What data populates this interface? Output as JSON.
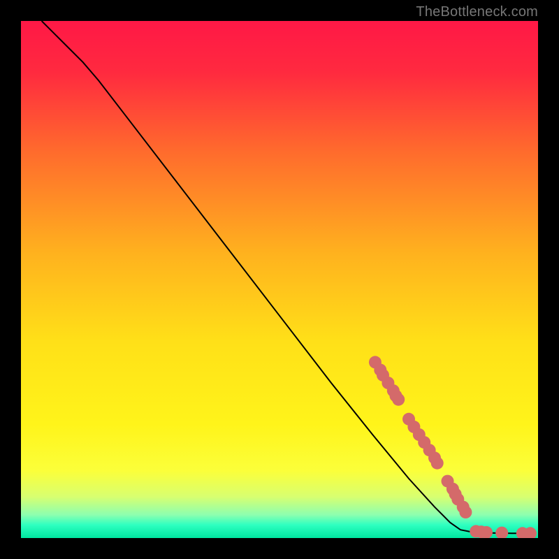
{
  "watermark": "TheBottleneck.com",
  "chart_data": {
    "type": "line",
    "title": "",
    "xlabel": "",
    "ylabel": "",
    "xlim": [
      0,
      100
    ],
    "ylim": [
      0,
      100
    ],
    "background_gradient_stops": [
      {
        "offset": 0.0,
        "color": "#ff1846"
      },
      {
        "offset": 0.1,
        "color": "#ff2a3f"
      },
      {
        "offset": 0.25,
        "color": "#ff6a2d"
      },
      {
        "offset": 0.45,
        "color": "#ffb21e"
      },
      {
        "offset": 0.62,
        "color": "#ffe018"
      },
      {
        "offset": 0.78,
        "color": "#fff41a"
      },
      {
        "offset": 0.87,
        "color": "#fbff3a"
      },
      {
        "offset": 0.92,
        "color": "#d8ff70"
      },
      {
        "offset": 0.955,
        "color": "#8dffaf"
      },
      {
        "offset": 0.975,
        "color": "#2dffc0"
      },
      {
        "offset": 1.0,
        "color": "#00e6a0"
      }
    ],
    "series": [
      {
        "name": "curve",
        "type": "line",
        "color": "#000000",
        "points": [
          {
            "x": 4,
            "y": 100
          },
          {
            "x": 6,
            "y": 98
          },
          {
            "x": 9,
            "y": 95
          },
          {
            "x": 12,
            "y": 92
          },
          {
            "x": 15,
            "y": 88.5
          },
          {
            "x": 20,
            "y": 82
          },
          {
            "x": 30,
            "y": 69
          },
          {
            "x": 40,
            "y": 56
          },
          {
            "x": 50,
            "y": 43
          },
          {
            "x": 60,
            "y": 30
          },
          {
            "x": 68,
            "y": 20
          },
          {
            "x": 75,
            "y": 11.5
          },
          {
            "x": 80,
            "y": 6
          },
          {
            "x": 83,
            "y": 3
          },
          {
            "x": 85,
            "y": 1.6
          },
          {
            "x": 87,
            "y": 1.2
          },
          {
            "x": 90,
            "y": 1.0
          },
          {
            "x": 95,
            "y": 0.9
          },
          {
            "x": 99,
            "y": 0.9
          }
        ]
      },
      {
        "name": "markers",
        "type": "scatter",
        "color": "#d46a6a",
        "points": [
          {
            "x": 68.5,
            "y": 34.0
          },
          {
            "x": 69.5,
            "y": 32.5
          },
          {
            "x": 70.0,
            "y": 31.5
          },
          {
            "x": 71.0,
            "y": 30.0
          },
          {
            "x": 72.0,
            "y": 28.5
          },
          {
            "x": 72.5,
            "y": 27.5
          },
          {
            "x": 73.0,
            "y": 26.8
          },
          {
            "x": 75.0,
            "y": 23.0
          },
          {
            "x": 76.0,
            "y": 21.5
          },
          {
            "x": 77.0,
            "y": 20.0
          },
          {
            "x": 78.0,
            "y": 18.5
          },
          {
            "x": 79.0,
            "y": 17.0
          },
          {
            "x": 80.0,
            "y": 15.5
          },
          {
            "x": 80.5,
            "y": 14.5
          },
          {
            "x": 82.5,
            "y": 11.0
          },
          {
            "x": 83.5,
            "y": 9.5
          },
          {
            "x": 84.0,
            "y": 8.5
          },
          {
            "x": 84.5,
            "y": 7.5
          },
          {
            "x": 85.5,
            "y": 6.0
          },
          {
            "x": 86.0,
            "y": 5.0
          },
          {
            "x": 88.0,
            "y": 1.3
          },
          {
            "x": 89.0,
            "y": 1.2
          },
          {
            "x": 90.0,
            "y": 1.1
          },
          {
            "x": 93.0,
            "y": 1.0
          },
          {
            "x": 97.0,
            "y": 0.9
          },
          {
            "x": 98.5,
            "y": 0.9
          }
        ]
      }
    ]
  }
}
